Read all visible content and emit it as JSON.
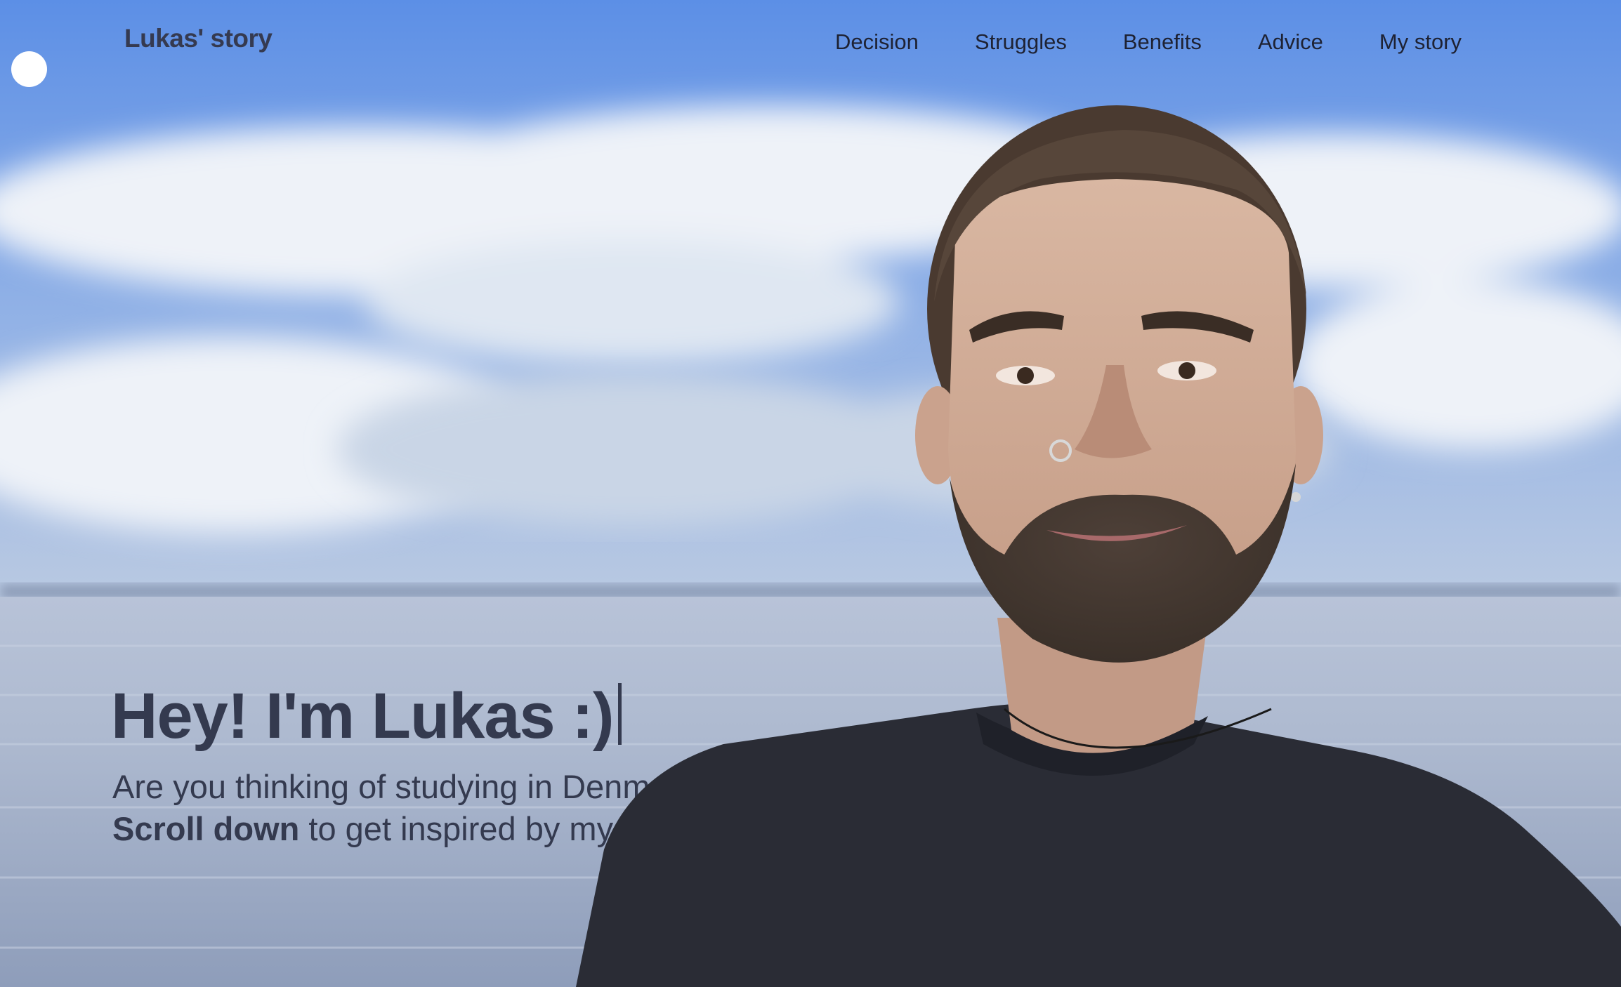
{
  "header": {
    "logo": "Lukas' story",
    "nav": [
      {
        "label": "Decision"
      },
      {
        "label": "Struggles"
      },
      {
        "label": "Benefits"
      },
      {
        "label": "Advice"
      },
      {
        "label": "My story"
      }
    ]
  },
  "hero": {
    "title": "Hey! I'm Lukas :)",
    "subtitle": "Are you thinking of studying in Denmark?",
    "cta_bold": "Scroll down",
    "cta_rest": " to get inspired by my story"
  },
  "colors": {
    "sky": "#5b8fe0",
    "text_dark": "#343a4f",
    "nav_text": "#1e2233"
  }
}
